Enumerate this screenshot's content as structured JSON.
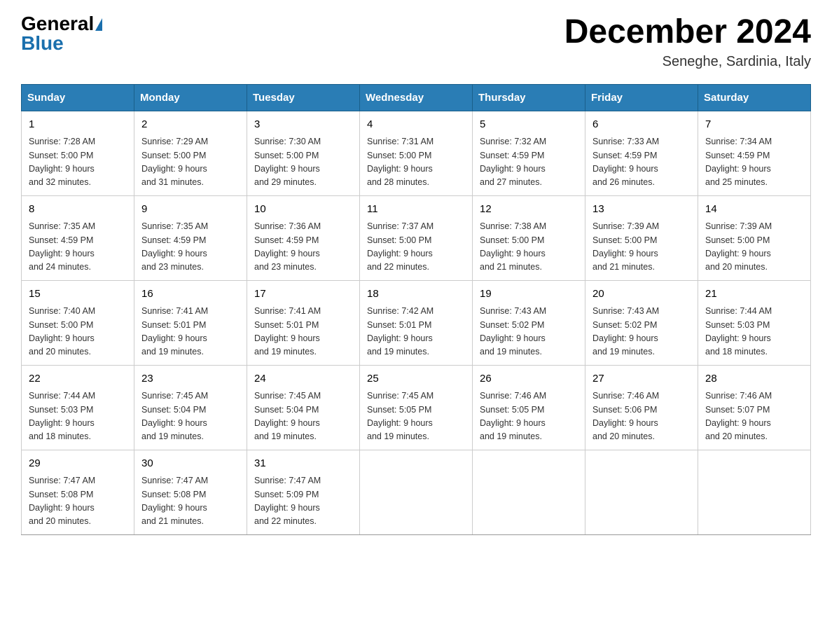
{
  "logo": {
    "general": "General",
    "blue": "Blue",
    "triangle": "▲"
  },
  "title": "December 2024",
  "location": "Seneghe, Sardinia, Italy",
  "headers": [
    "Sunday",
    "Monday",
    "Tuesday",
    "Wednesday",
    "Thursday",
    "Friday",
    "Saturday"
  ],
  "weeks": [
    [
      {
        "day": "1",
        "sunrise": "7:28 AM",
        "sunset": "5:00 PM",
        "daylight": "9 hours and 32 minutes."
      },
      {
        "day": "2",
        "sunrise": "7:29 AM",
        "sunset": "5:00 PM",
        "daylight": "9 hours and 31 minutes."
      },
      {
        "day": "3",
        "sunrise": "7:30 AM",
        "sunset": "5:00 PM",
        "daylight": "9 hours and 29 minutes."
      },
      {
        "day": "4",
        "sunrise": "7:31 AM",
        "sunset": "5:00 PM",
        "daylight": "9 hours and 28 minutes."
      },
      {
        "day": "5",
        "sunrise": "7:32 AM",
        "sunset": "4:59 PM",
        "daylight": "9 hours and 27 minutes."
      },
      {
        "day": "6",
        "sunrise": "7:33 AM",
        "sunset": "4:59 PM",
        "daylight": "9 hours and 26 minutes."
      },
      {
        "day": "7",
        "sunrise": "7:34 AM",
        "sunset": "4:59 PM",
        "daylight": "9 hours and 25 minutes."
      }
    ],
    [
      {
        "day": "8",
        "sunrise": "7:35 AM",
        "sunset": "4:59 PM",
        "daylight": "9 hours and 24 minutes."
      },
      {
        "day": "9",
        "sunrise": "7:35 AM",
        "sunset": "4:59 PM",
        "daylight": "9 hours and 23 minutes."
      },
      {
        "day": "10",
        "sunrise": "7:36 AM",
        "sunset": "4:59 PM",
        "daylight": "9 hours and 23 minutes."
      },
      {
        "day": "11",
        "sunrise": "7:37 AM",
        "sunset": "5:00 PM",
        "daylight": "9 hours and 22 minutes."
      },
      {
        "day": "12",
        "sunrise": "7:38 AM",
        "sunset": "5:00 PM",
        "daylight": "9 hours and 21 minutes."
      },
      {
        "day": "13",
        "sunrise": "7:39 AM",
        "sunset": "5:00 PM",
        "daylight": "9 hours and 21 minutes."
      },
      {
        "day": "14",
        "sunrise": "7:39 AM",
        "sunset": "5:00 PM",
        "daylight": "9 hours and 20 minutes."
      }
    ],
    [
      {
        "day": "15",
        "sunrise": "7:40 AM",
        "sunset": "5:00 PM",
        "daylight": "9 hours and 20 minutes."
      },
      {
        "day": "16",
        "sunrise": "7:41 AM",
        "sunset": "5:01 PM",
        "daylight": "9 hours and 19 minutes."
      },
      {
        "day": "17",
        "sunrise": "7:41 AM",
        "sunset": "5:01 PM",
        "daylight": "9 hours and 19 minutes."
      },
      {
        "day": "18",
        "sunrise": "7:42 AM",
        "sunset": "5:01 PM",
        "daylight": "9 hours and 19 minutes."
      },
      {
        "day": "19",
        "sunrise": "7:43 AM",
        "sunset": "5:02 PM",
        "daylight": "9 hours and 19 minutes."
      },
      {
        "day": "20",
        "sunrise": "7:43 AM",
        "sunset": "5:02 PM",
        "daylight": "9 hours and 19 minutes."
      },
      {
        "day": "21",
        "sunrise": "7:44 AM",
        "sunset": "5:03 PM",
        "daylight": "9 hours and 18 minutes."
      }
    ],
    [
      {
        "day": "22",
        "sunrise": "7:44 AM",
        "sunset": "5:03 PM",
        "daylight": "9 hours and 18 minutes."
      },
      {
        "day": "23",
        "sunrise": "7:45 AM",
        "sunset": "5:04 PM",
        "daylight": "9 hours and 19 minutes."
      },
      {
        "day": "24",
        "sunrise": "7:45 AM",
        "sunset": "5:04 PM",
        "daylight": "9 hours and 19 minutes."
      },
      {
        "day": "25",
        "sunrise": "7:45 AM",
        "sunset": "5:05 PM",
        "daylight": "9 hours and 19 minutes."
      },
      {
        "day": "26",
        "sunrise": "7:46 AM",
        "sunset": "5:05 PM",
        "daylight": "9 hours and 19 minutes."
      },
      {
        "day": "27",
        "sunrise": "7:46 AM",
        "sunset": "5:06 PM",
        "daylight": "9 hours and 20 minutes."
      },
      {
        "day": "28",
        "sunrise": "7:46 AM",
        "sunset": "5:07 PM",
        "daylight": "9 hours and 20 minutes."
      }
    ],
    [
      {
        "day": "29",
        "sunrise": "7:47 AM",
        "sunset": "5:08 PM",
        "daylight": "9 hours and 20 minutes."
      },
      {
        "day": "30",
        "sunrise": "7:47 AM",
        "sunset": "5:08 PM",
        "daylight": "9 hours and 21 minutes."
      },
      {
        "day": "31",
        "sunrise": "7:47 AM",
        "sunset": "5:09 PM",
        "daylight": "9 hours and 22 minutes."
      },
      null,
      null,
      null,
      null
    ]
  ],
  "labels": {
    "sunrise": "Sunrise:",
    "sunset": "Sunset:",
    "daylight": "Daylight:"
  }
}
